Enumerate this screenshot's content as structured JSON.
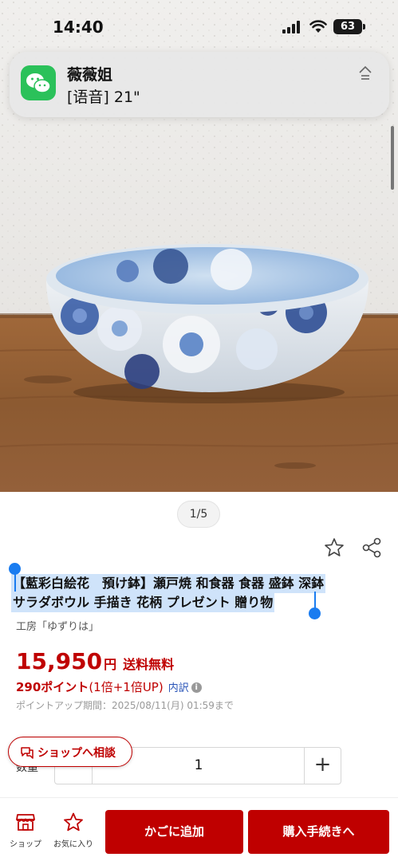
{
  "status_bar": {
    "time": "14:40",
    "battery": "63"
  },
  "notification": {
    "title": "薇薇姐",
    "body": "[语音] 21\"",
    "side_icon": "focus-arrow-icon"
  },
  "product": {
    "image_pager": "1/5",
    "title_line1": "【藍彩白絵花　預け鉢】瀬戸焼 和食器 食器 盛鉢 深鉢",
    "title_line2": "サラダボウル 手描き 花柄 プレゼント 贈り物",
    "shop_name": "工房「ゆずりは」",
    "price": "15,950",
    "currency": "円",
    "shipping": "送料無料",
    "points": "290ポイント",
    "points_rate": "(1倍+1倍UP)",
    "points_breakdown": "内訳",
    "points_deadline": "ポイントアップ期間：2025/08/11(月) 01:59まで"
  },
  "quantity": {
    "label": "数量",
    "value": "1",
    "plus": "+"
  },
  "consult_button": {
    "label": "ショップへ相談"
  },
  "bottom_bar": {
    "shop_label": "ショップ",
    "favorite_label": "お気に入り",
    "cart_label": "かごに追加",
    "buy_label": "購入手続きへ"
  },
  "colors": {
    "accent": "#bf0000",
    "selection": "#cfe3fa",
    "handle": "#1a7cf0"
  }
}
